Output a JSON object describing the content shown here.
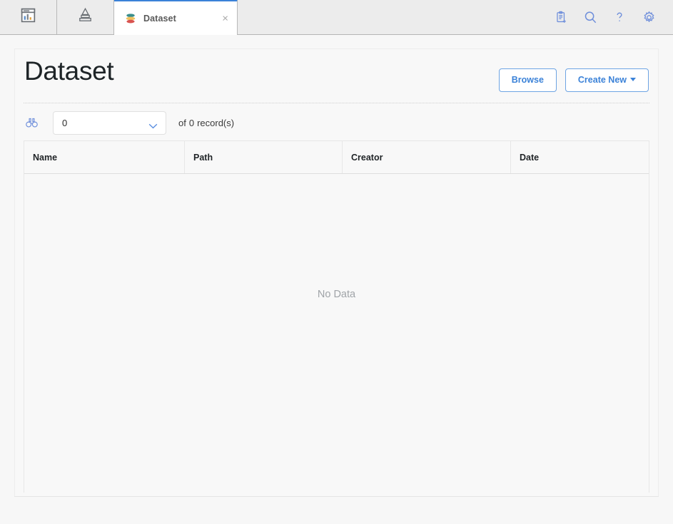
{
  "tabbar": {
    "tabs": [
      {
        "name": "dashboard",
        "icon": "dashboard-chart-icon",
        "label": ""
      },
      {
        "name": "pyramid",
        "icon": "pyramid-chart-icon",
        "label": ""
      },
      {
        "name": "dataset",
        "icon": "dataset-discs-icon",
        "label": "Dataset",
        "close": "×",
        "active": true
      }
    ],
    "toolbar": [
      {
        "name": "new-note-icon",
        "title": "New"
      },
      {
        "name": "search-icon",
        "title": "Search"
      },
      {
        "name": "help-icon",
        "title": "Help"
      },
      {
        "name": "settings-gear-icon",
        "title": "Settings"
      }
    ]
  },
  "page": {
    "title": "Dataset",
    "browse_label": "Browse",
    "create_new_label": "Create New"
  },
  "filter": {
    "binoculars_icon": "binoculars-icon",
    "select_value": "0",
    "record_prefix": "of",
    "record_count": "0",
    "record_suffix": "record(s)"
  },
  "table": {
    "columns": [
      "Name",
      "Path",
      "Creator",
      "Date"
    ],
    "rows": [],
    "empty_message": "No Data"
  },
  "colors": {
    "accent_blue": "#3b82d8",
    "tab_active_border": "#3b82d8",
    "icon_teal": "#3a8e8c",
    "icon_yellow": "#efc15f",
    "icon_red": "#d9534f",
    "text_dark": "#1e2427",
    "muted": "#a0a4a8"
  }
}
